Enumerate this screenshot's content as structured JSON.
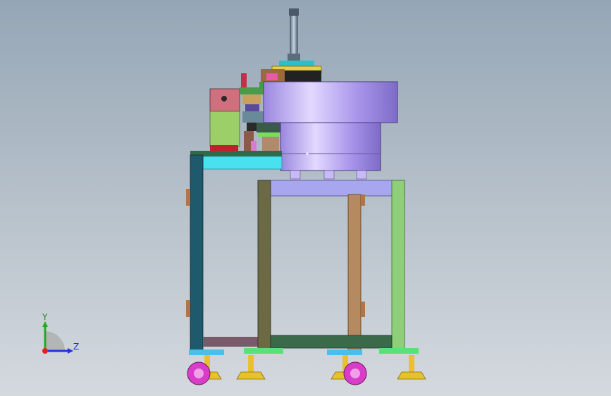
{
  "triad": {
    "y_label": "Y",
    "z_label": "Z"
  },
  "colors": {
    "bowl": "#b79cf0",
    "frame_teal": "#1f5a6c",
    "frame_green": "#8fcf7a",
    "frame_olive": "#6b6a45",
    "frame_tan": "#b58a60",
    "cyan_plate": "#49e0f0",
    "lilac_bar": "#a9a6f0",
    "caster_magenta": "#d83cc8",
    "foot_yellow": "#e8c22c"
  }
}
